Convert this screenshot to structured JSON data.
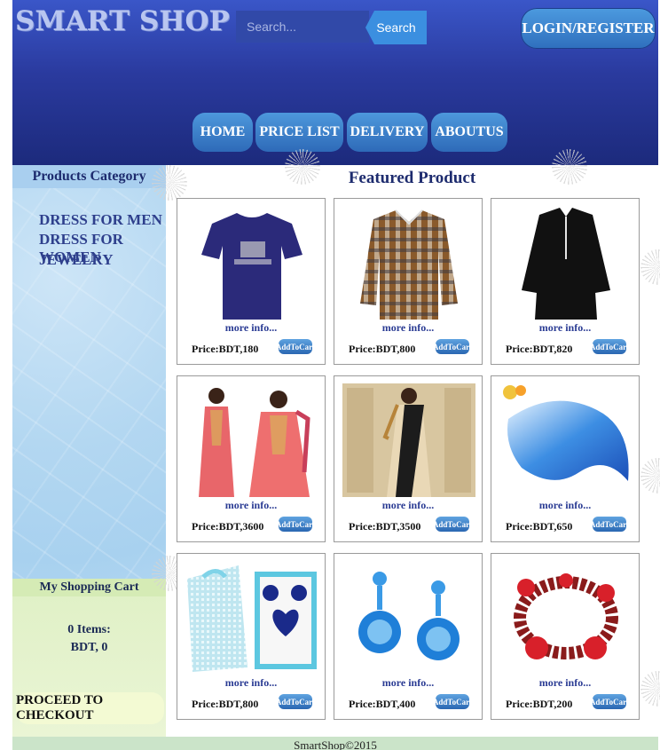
{
  "header": {
    "logo": "SMART SHOP",
    "search_placeholder": "Search...",
    "search_button": "Search",
    "login_button": "LOGIN/REGISTER"
  },
  "nav": {
    "home": "HOME",
    "price_list": "PRICE LIST",
    "delivery": "DELIVERY",
    "about": "ABOUTUS"
  },
  "sidebar": {
    "category_title": "Products Category",
    "categories": [
      "DRESS FOR MEN",
      "DRESS FOR WOMEN",
      "JEWELRY"
    ]
  },
  "cart": {
    "title": "My Shopping Cart",
    "items": "0 Items:",
    "total": "BDT, 0",
    "checkout": "PROCEED TO CHECKOUT"
  },
  "main": {
    "title": "Featured Product",
    "products": [
      {
        "image": "purple-tshirt",
        "more": "more info...",
        "price": "Price:BDT,180",
        "button": "AddToCart"
      },
      {
        "image": "checked-shirt",
        "more": "more info...",
        "price": "Price:BDT,800",
        "button": "AddToCart"
      },
      {
        "image": "black-kurta",
        "more": "more info...",
        "price": "Price:BDT,820",
        "button": "AddToCart"
      },
      {
        "image": "salwar-kameez",
        "more": "more info...",
        "price": "Price:BDT,3600",
        "button": "AddToCart"
      },
      {
        "image": "saree",
        "more": "more info...",
        "price": "Price:BDT,3500",
        "button": "AddToCart"
      },
      {
        "image": "blue-scarf",
        "more": "more info...",
        "price": "Price:BDT,650",
        "button": "AddToCart"
      },
      {
        "image": "heart-jewelry-set",
        "more": "more info...",
        "price": "Price:BDT,800",
        "button": "AddToCart"
      },
      {
        "image": "blue-flower-earrings",
        "more": "more info...",
        "price": "Price:BDT,400",
        "button": "AddToCart"
      },
      {
        "image": "red-bead-bracelet",
        "more": "more info...",
        "price": "Price:BDT,200",
        "button": "AddToCart"
      }
    ]
  },
  "footer": {
    "text": "SmartShop©2015"
  }
}
